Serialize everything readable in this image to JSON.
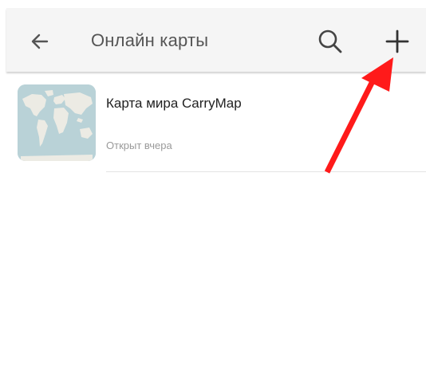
{
  "app_bar": {
    "title": "Онлайн карты",
    "back_icon": "arrow-left-icon",
    "search_icon": "search-icon",
    "add_icon": "plus-icon"
  },
  "maps_list": [
    {
      "title": "Карта мира CarryMap",
      "subtitle": "Открыт вчера",
      "thumbnail_icon": "world-map-thumbnail"
    }
  ],
  "annotation": {
    "arrow_color": "#ff1a1a"
  },
  "colors": {
    "app_bar_background": "#f5f5f5",
    "title_text": "#555555",
    "subtitle_text": "#9a9a9a",
    "thumbnail_water": "#b9d2d7",
    "thumbnail_land": "#ecebe4"
  }
}
